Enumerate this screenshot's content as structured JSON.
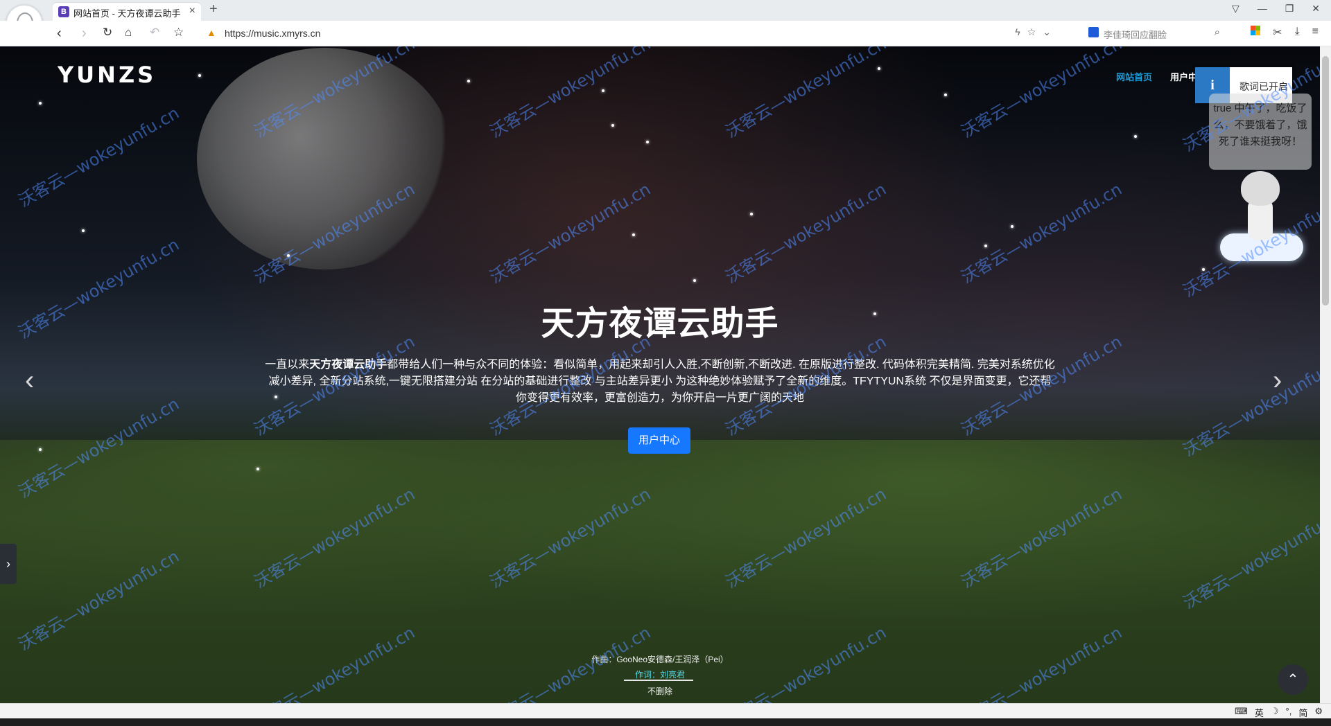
{
  "browser": {
    "tab_title": "网站首页 - 天方夜谭云助手",
    "tab_favicon": "B",
    "url": "https://music.xmyrs.cn",
    "search_placeholder": "李佳琦回应翻脸"
  },
  "site": {
    "logo": "YUNZS",
    "nav": [
      {
        "label": "网站首页"
      },
      {
        "label": "用户中"
      }
    ]
  },
  "notification": {
    "icon_label": "i",
    "text": "歌词已开启"
  },
  "mascot_bubble": "true 中午了，吃饭了么，不要饿着了，饿死了谁来挺我呀！",
  "hero": {
    "title": "天方夜谭云助手",
    "description_bold": "天方夜谭云助手",
    "description_prefix": "一直以来",
    "description_rest": "都带给人们一种与众不同的体验：看似简单，用起来却引人入胜,不断创新,不断改进. 在原版进行整改. 代码体积完美精简. 完美对系统优化减小差异, 全新分站系统,一键无限搭建分站 在分站的基础进行整改 与主站差异更小 为这种绝妙体验赋予了全新的维度。TFYTYUN系统 不仅是界面变更，它还帮你变得更有效率，更富创造力，为你开启一片更广阔的天地",
    "button_label": "用户中心"
  },
  "lyrics": {
    "line1": "作曲：GooNeo安德森/王润泽（Pei）",
    "line2": "作词：刘亮君",
    "line3": "不删除"
  },
  "watermark_text": "沃客云—wokeyunfu.cn",
  "status_tray": {
    "ime": "英",
    "mode": "简"
  },
  "colors": {
    "accent": "#1677ff",
    "nav_active": "#18a0e0",
    "info_blue": "#2b78c5",
    "lyric_highlight": "#58d8e8"
  }
}
